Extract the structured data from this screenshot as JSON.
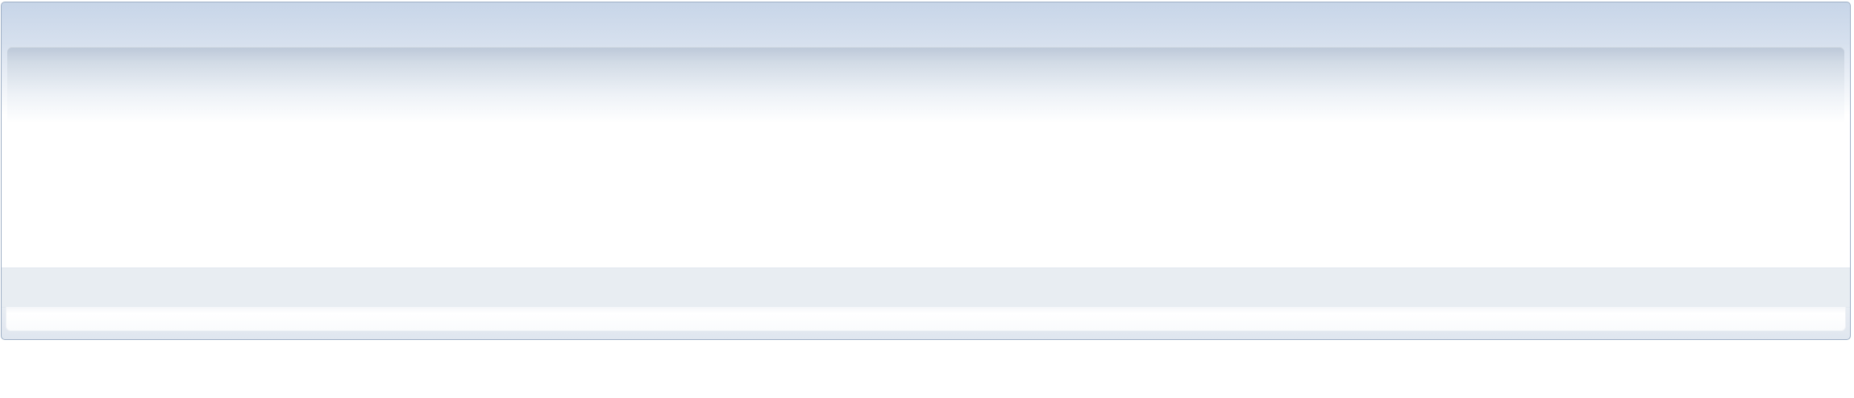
{
  "window": {
    "title": "",
    "status_text": ""
  },
  "colors": {
    "frame_border": "#9fb0c6",
    "title_gradient_top": "#c7d5e8",
    "panel_shade": "#bcc8d8",
    "status_strip": "#e8edf2",
    "background": "#ffffff"
  }
}
